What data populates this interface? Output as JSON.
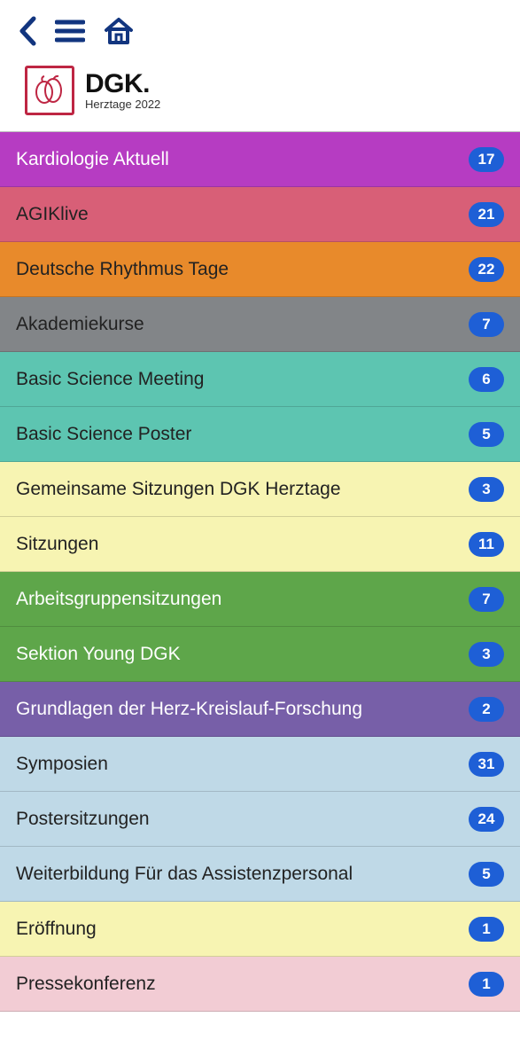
{
  "logo": {
    "title": "DGK.",
    "subtitle": "Herztage 2022"
  },
  "badge_bg": "#1E5FD6",
  "categories": [
    {
      "label": "Kardiologie Aktuell",
      "count": 17,
      "bg": "#B63CC2",
      "light": true
    },
    {
      "label": "AGIKlive",
      "count": 21,
      "bg": "#D85F77",
      "light": false
    },
    {
      "label": "Deutsche Rhythmus Tage",
      "count": 22,
      "bg": "#E88A2B",
      "light": false
    },
    {
      "label": "Akademiekurse",
      "count": 7,
      "bg": "#828588",
      "light": false
    },
    {
      "label": "Basic Science Meeting",
      "count": 6,
      "bg": "#5DC5B1",
      "light": false
    },
    {
      "label": "Basic Science Poster",
      "count": 5,
      "bg": "#5DC5B1",
      "light": false
    },
    {
      "label": "Gemeinsame Sitzungen DGK Herztage",
      "count": 3,
      "bg": "#F7F4B2",
      "light": false
    },
    {
      "label": "Sitzungen",
      "count": 11,
      "bg": "#F7F4B2",
      "light": false
    },
    {
      "label": "Arbeitsgruppensitzungen",
      "count": 7,
      "bg": "#5EA64A",
      "light": true
    },
    {
      "label": "Sektion Young DGK",
      "count": 3,
      "bg": "#5EA64A",
      "light": true
    },
    {
      "label": "Grundlagen der Herz-Kreislauf-Forschung",
      "count": 2,
      "bg": "#775FA8",
      "light": true
    },
    {
      "label": "Symposien",
      "count": 31,
      "bg": "#BFD9E7",
      "light": false
    },
    {
      "label": "Postersitzungen",
      "count": 24,
      "bg": "#BFD9E7",
      "light": false
    },
    {
      "label": "Weiterbildung Für das Assistenzpersonal",
      "count": 5,
      "bg": "#BFD9E7",
      "light": false
    },
    {
      "label": "Eröffnung",
      "count": 1,
      "bg": "#F7F4B2",
      "light": false
    },
    {
      "label": "Pressekonferenz",
      "count": 1,
      "bg": "#F2CCD4",
      "light": false
    }
  ]
}
